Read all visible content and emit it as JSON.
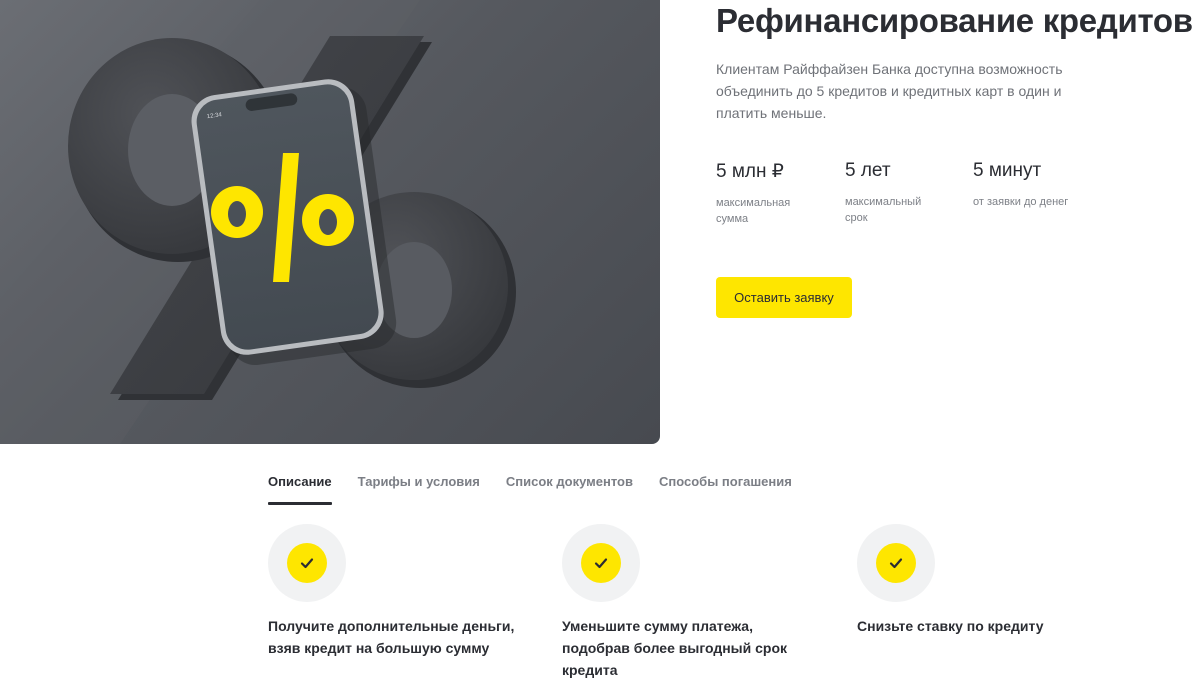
{
  "hero": {
    "title": "Рефинансирование кредитов",
    "description": "Клиентам Райффайзен Банка доступна возможность объединить до 5 кредитов и кредитных карт в один и платить меньше.",
    "stats": [
      {
        "value": "5 млн ₽",
        "label_line1": "максимальная",
        "label_line2": "сумма"
      },
      {
        "value": "5 лет",
        "label_line1": "максимальный",
        "label_line2": "срок"
      },
      {
        "value": "5 минут",
        "label_line1": "от заявки до денег",
        "label_line2": ""
      }
    ],
    "apply_label": "Оставить заявку",
    "phone_time": "12:34"
  },
  "tabs": [
    {
      "label": "Описание",
      "active": true
    },
    {
      "label": "Тарифы и условия",
      "active": false
    },
    {
      "label": "Список документов",
      "active": false
    },
    {
      "label": "Способы погашения",
      "active": false
    }
  ],
  "features": [
    {
      "text": "Получите дополнительные деньги, взяв кредит на большую сумму",
      "icon": "check-icon"
    },
    {
      "text": "Уменьшите сумму платежа, подобрав более выгодный срок кредита",
      "icon": "check-icon"
    },
    {
      "text": "Снизьте ставку по кредиту",
      "icon": "check-icon"
    }
  ],
  "colors": {
    "accent": "#fee600",
    "text": "#2b2d33",
    "muted": "#6f7278",
    "hero_bg": "#56595f"
  }
}
